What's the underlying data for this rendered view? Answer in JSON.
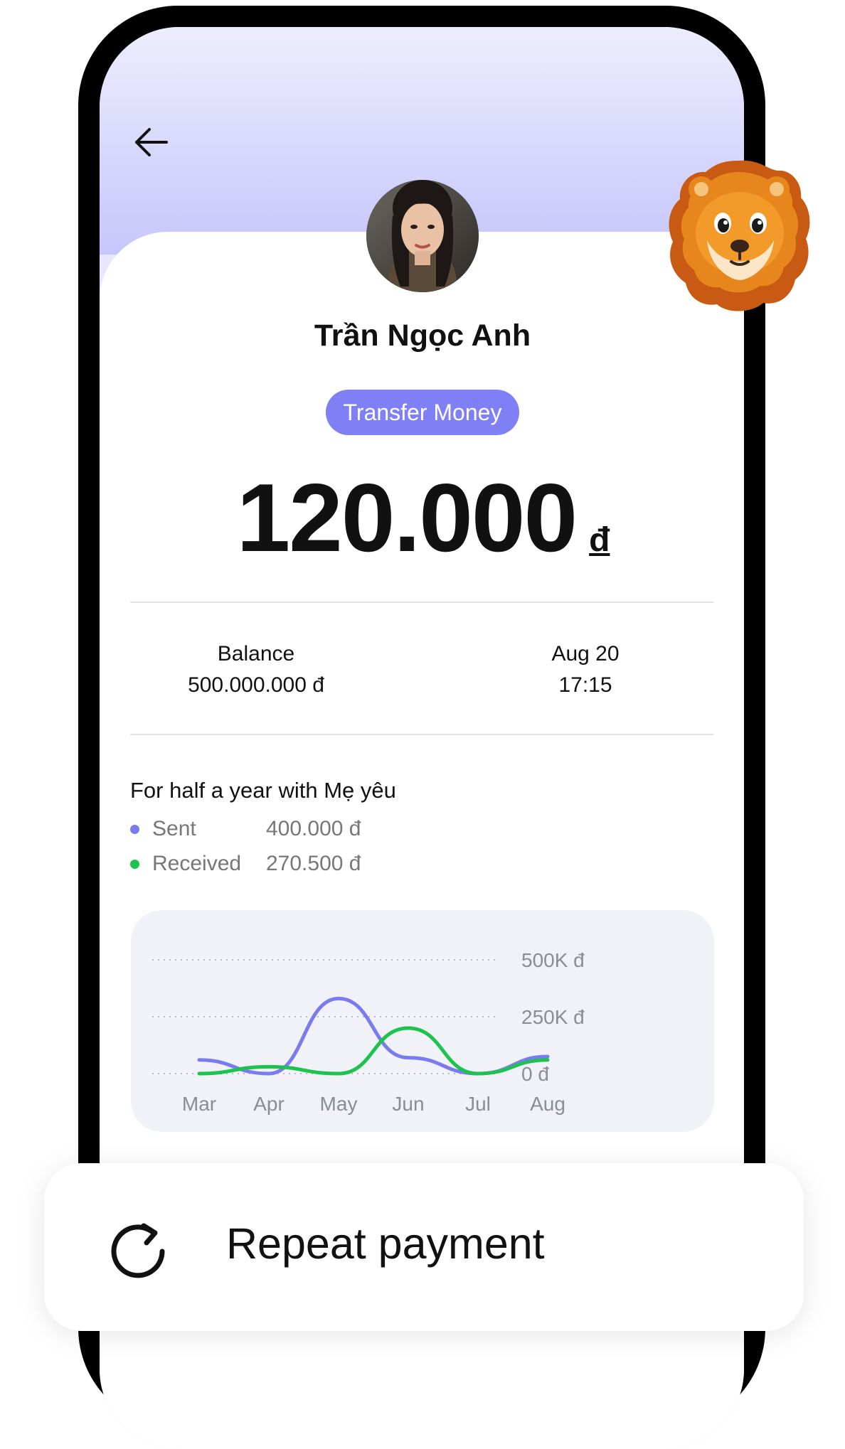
{
  "contact": {
    "name": "Trần Ngọc Anh",
    "tag": "Transfer Money"
  },
  "transfer": {
    "amount": "120.000",
    "currency": "đ"
  },
  "details": {
    "balance_label": "Balance",
    "balance_value": "500.000.000 đ",
    "date": "Aug 20",
    "time": "17:15"
  },
  "summary": {
    "title": "For half a year with Mẹ yêu",
    "sent_label": "Sent",
    "sent_value": "400.000 đ",
    "received_label": "Received",
    "received_value": "270.500 đ"
  },
  "colors": {
    "accent": "#8080f6",
    "sent": "#7b7bf0",
    "received": "#1ec34f",
    "header_gradient_top": "#ededfd",
    "header_gradient_bottom": "#c6c6fb"
  },
  "icons": {
    "back": "arrow-left-icon",
    "repeat": "refresh-icon",
    "sticker": "lion-emoji"
  },
  "chart_data": {
    "type": "line",
    "categories": [
      "Mar",
      "Apr",
      "May",
      "Jun",
      "Jul",
      "Aug"
    ],
    "series": [
      {
        "name": "Sent",
        "values": [
          60,
          0,
          330,
          70,
          0,
          75
        ]
      },
      {
        "name": "Received",
        "values": [
          0,
          30,
          0,
          200,
          0,
          60
        ]
      }
    ],
    "y_tick_labels": [
      "500K đ",
      "250K đ",
      "0 đ"
    ],
    "y_ticks": [
      500,
      250,
      0
    ],
    "ylim": [
      0,
      500
    ],
    "grid": true,
    "y_axis_position": "right"
  },
  "action": {
    "repeat_label": "Repeat payment"
  }
}
